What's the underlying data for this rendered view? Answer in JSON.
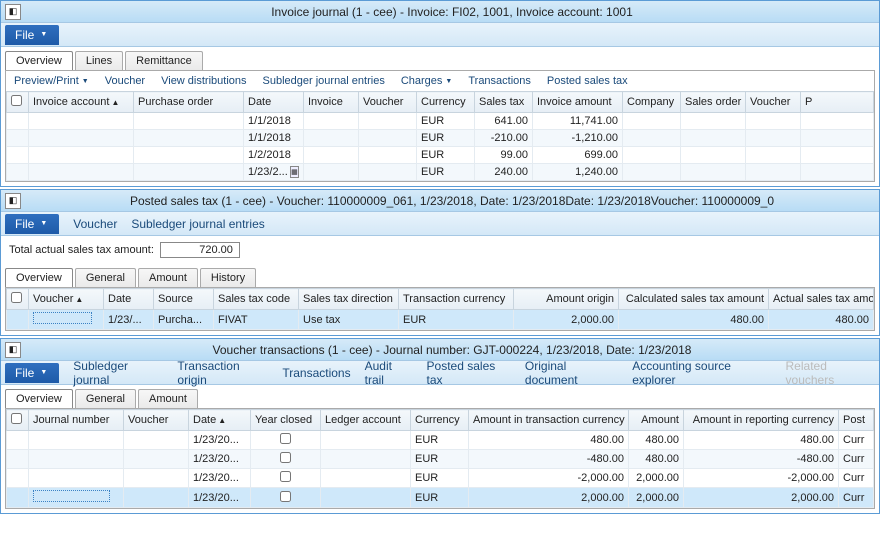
{
  "win1": {
    "title": "Invoice journal (1 - cee) - Invoice: FI02, 1001, Invoice account: 1001",
    "file": "File",
    "tabs": [
      "Overview",
      "Lines",
      "Remittance"
    ],
    "toolbar": [
      "Preview/Print",
      "Voucher",
      "View distributions",
      "Subledger journal entries",
      "Charges",
      "Transactions",
      "Posted sales tax"
    ],
    "toolbar_dd": [
      true,
      false,
      false,
      false,
      true,
      false,
      false
    ],
    "cols": [
      "Invoice account",
      "Purchase order",
      "Date",
      "Invoice",
      "Voucher",
      "Currency",
      "Sales tax",
      "Invoice amount",
      "Company",
      "Sales order",
      "Voucher",
      "P"
    ],
    "rows": [
      {
        "date": "1/1/2018",
        "cur": "EUR",
        "tax": "641.00",
        "amt": "11,741.00"
      },
      {
        "date": "1/1/2018",
        "cur": "EUR",
        "tax": "-210.00",
        "amt": "-1,210.00"
      },
      {
        "date": "1/2/2018",
        "cur": "EUR",
        "tax": "99.00",
        "amt": "699.00"
      },
      {
        "date": "1/23/2...",
        "cur": "EUR",
        "tax": "240.00",
        "amt": "1,240.00",
        "picker": true
      }
    ]
  },
  "win2": {
    "title": "Posted sales tax (1 - cee) - Voucher: 110000009_061, 1/23/2018, Date: 1/23/2018Date: 1/23/2018Voucher: 110000009_0",
    "file": "File",
    "menu": [
      "Voucher",
      "Subledger journal entries"
    ],
    "total_label": "Total actual sales tax amount:",
    "total_value": "720.00",
    "tabs": [
      "Overview",
      "General",
      "Amount",
      "History"
    ],
    "cols": [
      "Voucher",
      "Date",
      "Source",
      "Sales tax code",
      "Sales tax direction",
      "Transaction currency",
      "Amount origin",
      "Calculated sales tax amount",
      "Actual sales tax amount"
    ],
    "row": {
      "date": "1/23/...",
      "source": "Purcha...",
      "code": "FIVAT",
      "dir": "Use tax",
      "cur": "EUR",
      "orig": "2,000.00",
      "calc": "480.00",
      "act": "480.00"
    }
  },
  "win3": {
    "title": "Voucher transactions (1 - cee) - Journal number: GJT-000224, 1/23/2018, Date: 1/23/2018",
    "file": "File",
    "menu": [
      "Subledger journal",
      "Transaction origin",
      "Transactions",
      "Audit trail",
      "Posted sales tax",
      "Original document",
      "Accounting source explorer",
      "Related vouchers"
    ],
    "tabs": [
      "Overview",
      "General",
      "Amount"
    ],
    "cols": [
      "Journal number",
      "Voucher",
      "Date",
      "Year closed",
      "Ledger account",
      "Currency",
      "Amount in transaction currency",
      "Amount",
      "Amount in reporting currency",
      "Post"
    ],
    "rows": [
      {
        "date": "1/23/20...",
        "cur": "EUR",
        "atc": "480.00",
        "amt": "480.00",
        "arc": "480.00",
        "post": "Curr"
      },
      {
        "date": "1/23/20...",
        "cur": "EUR",
        "atc": "-480.00",
        "amt": "480.00",
        "arc": "-480.00",
        "post": "Curr"
      },
      {
        "date": "1/23/20...",
        "cur": "EUR",
        "atc": "-2,000.00",
        "amt": "2,000.00",
        "arc": "-2,000.00",
        "post": "Curr"
      },
      {
        "date": "1/23/20...",
        "cur": "EUR",
        "atc": "2,000.00",
        "amt": "2,000.00",
        "arc": "2,000.00",
        "post": "Curr",
        "sel": true
      }
    ]
  }
}
